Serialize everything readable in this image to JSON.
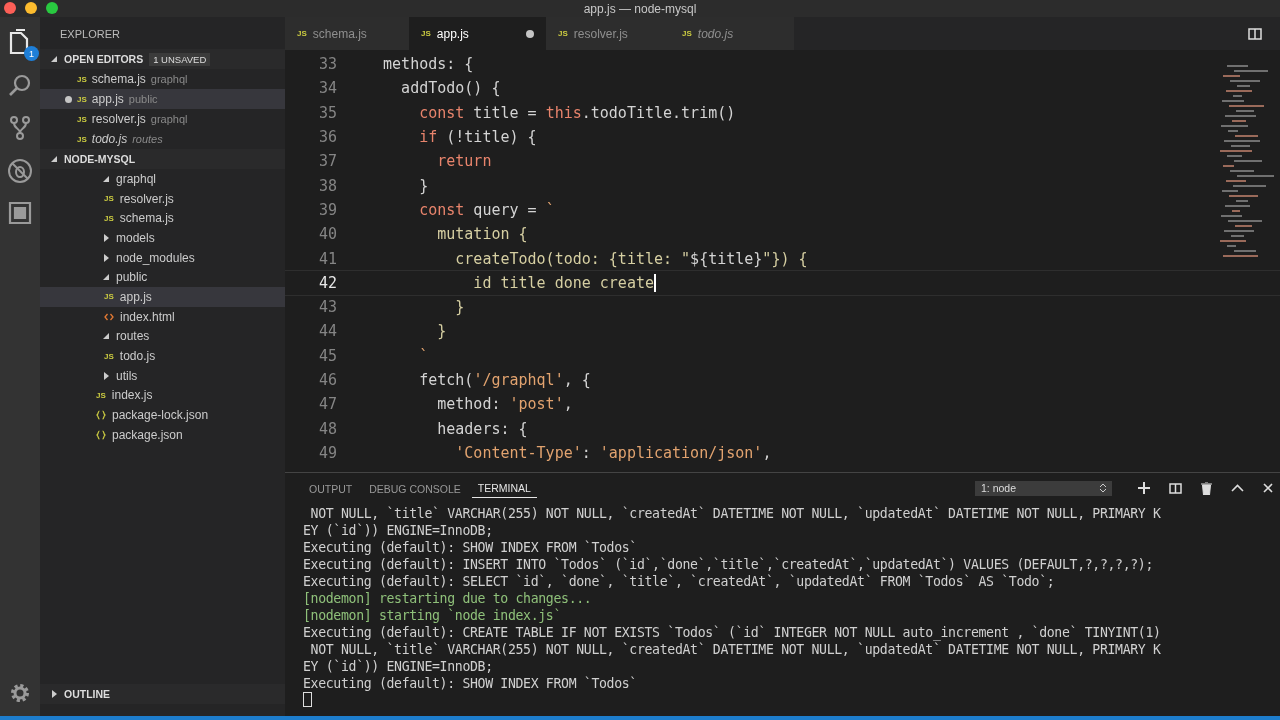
{
  "window": {
    "title": "app.js — node-mysql"
  },
  "activity_bar": {
    "explorer_badge": "1"
  },
  "sidebar": {
    "title": "EXPLORER",
    "open_editors": {
      "title": "OPEN EDITORS",
      "badge": "1 UNSAVED",
      "expanded": true,
      "items": [
        {
          "icon": "JS",
          "name": "schema.js",
          "folder": "graphql",
          "unsaved": false,
          "preview": false,
          "selected": false
        },
        {
          "icon": "JS",
          "name": "app.js",
          "folder": "public",
          "unsaved": true,
          "preview": false,
          "selected": true
        },
        {
          "icon": "JS",
          "name": "resolver.js",
          "folder": "graphql",
          "unsaved": false,
          "preview": false,
          "selected": false
        },
        {
          "icon": "JS",
          "name": "todo.js",
          "folder": "routes",
          "unsaved": false,
          "preview": true,
          "selected": false
        }
      ]
    },
    "project": {
      "title": "NODE-MYSQL",
      "expanded": true,
      "tree": [
        {
          "name": "graphql",
          "kind": "folder",
          "expanded": true,
          "selected": false,
          "children": [
            {
              "icon": "JS",
              "name": "resolver.js",
              "kind": "js",
              "selected": false
            },
            {
              "icon": "JS",
              "name": "schema.js",
              "kind": "js",
              "selected": false
            }
          ]
        },
        {
          "name": "models",
          "kind": "folder",
          "expanded": false,
          "selected": false
        },
        {
          "name": "node_modules",
          "kind": "folder",
          "expanded": false,
          "selected": false
        },
        {
          "name": "public",
          "kind": "folder",
          "expanded": true,
          "selected": false,
          "children": [
            {
              "icon": "JS",
              "name": "app.js",
              "kind": "js",
              "selected": true
            },
            {
              "name": "index.html",
              "kind": "html",
              "selected": false
            }
          ]
        },
        {
          "name": "routes",
          "kind": "folder",
          "expanded": true,
          "selected": false,
          "children": [
            {
              "icon": "JS",
              "name": "todo.js",
              "kind": "js",
              "selected": false
            }
          ]
        },
        {
          "name": "utils",
          "kind": "folder",
          "expanded": false,
          "selected": false
        },
        {
          "icon": "JS",
          "name": "index.js",
          "kind": "js",
          "selected": false
        },
        {
          "name": "package-lock.json",
          "kind": "json",
          "selected": false
        },
        {
          "name": "package.json",
          "kind": "json",
          "selected": false
        }
      ]
    },
    "outline": {
      "title": "OUTLINE",
      "expanded": false
    }
  },
  "tabs": [
    {
      "icon": "JS",
      "label": "schema.js",
      "selected": false,
      "unsaved": false,
      "preview": false
    },
    {
      "icon": "JS",
      "label": "app.js",
      "selected": true,
      "unsaved": true,
      "preview": false
    },
    {
      "icon": "JS",
      "label": "resolver.js",
      "selected": false,
      "unsaved": false,
      "preview": false
    },
    {
      "icon": "JS",
      "label": "todo.js",
      "selected": false,
      "unsaved": false,
      "preview": true
    }
  ],
  "editor": {
    "lines": [
      {
        "number": "33",
        "current": false,
        "tokens": [
          {
            "text": "  methods: {",
            "kind": "plain"
          }
        ]
      },
      {
        "number": "34",
        "current": false,
        "tokens": [
          {
            "text": "    addTodo() {",
            "kind": "plain"
          }
        ]
      },
      {
        "number": "35",
        "current": false,
        "tokens": [
          {
            "text": "      const",
            "kind": "keyword"
          },
          {
            "text": " title = ",
            "kind": "plain"
          },
          {
            "text": "this",
            "kind": "keyword"
          },
          {
            "text": ".todoTitle.trim()",
            "kind": "plain"
          }
        ]
      },
      {
        "number": "36",
        "current": false,
        "tokens": [
          {
            "text": "      if",
            "kind": "keyword"
          },
          {
            "text": " (!title) {",
            "kind": "plain"
          }
        ]
      },
      {
        "number": "37",
        "current": false,
        "tokens": [
          {
            "text": "        return",
            "kind": "keyword"
          }
        ]
      },
      {
        "number": "38",
        "current": false,
        "tokens": [
          {
            "text": "      }",
            "kind": "plain"
          }
        ]
      },
      {
        "number": "39",
        "current": false,
        "tokens": [
          {
            "text": "      const",
            "kind": "keyword"
          },
          {
            "text": " query = ",
            "kind": "plain"
          },
          {
            "text": "`",
            "kind": "string"
          }
        ]
      },
      {
        "number": "40",
        "current": false,
        "tokens": [
          {
            "text": "        mutation {",
            "kind": "template"
          }
        ]
      },
      {
        "number": "41",
        "current": false,
        "tokens": [
          {
            "text": "          createTodo(todo: {title: \"",
            "kind": "template"
          },
          {
            "text": "${title}",
            "kind": "plain"
          },
          {
            "text": "\"}) {",
            "kind": "template"
          }
        ]
      },
      {
        "number": "42",
        "current": true,
        "tokens": [
          {
            "text": "            id title done create",
            "kind": "template"
          }
        ]
      },
      {
        "number": "43",
        "current": false,
        "tokens": [
          {
            "text": "          }",
            "kind": "template"
          }
        ]
      },
      {
        "number": "44",
        "current": false,
        "tokens": [
          {
            "text": "        }",
            "kind": "template"
          }
        ]
      },
      {
        "number": "45",
        "current": false,
        "tokens": [
          {
            "text": "      `",
            "kind": "string"
          }
        ]
      },
      {
        "number": "46",
        "current": false,
        "tokens": [
          {
            "text": "      fetch(",
            "kind": "plain"
          },
          {
            "text": "'/graphql'",
            "kind": "string"
          },
          {
            "text": ", {",
            "kind": "plain"
          }
        ]
      },
      {
        "number": "47",
        "current": false,
        "tokens": [
          {
            "text": "        method: ",
            "kind": "plain"
          },
          {
            "text": "'post'",
            "kind": "string"
          },
          {
            "text": ",",
            "kind": "plain"
          }
        ]
      },
      {
        "number": "48",
        "current": false,
        "tokens": [
          {
            "text": "        headers: {",
            "kind": "plain"
          }
        ]
      },
      {
        "number": "49",
        "current": false,
        "tokens": [
          {
            "text": "          'Content-Type'",
            "kind": "string"
          },
          {
            "text": ": ",
            "kind": "plain"
          },
          {
            "text": "'application/json'",
            "kind": "string"
          },
          {
            "text": ",",
            "kind": "plain"
          }
        ]
      }
    ]
  },
  "panel": {
    "tabs": [
      {
        "label": "OUTPUT",
        "selected": false
      },
      {
        "label": "DEBUG CONSOLE",
        "selected": false
      },
      {
        "label": "TERMINAL",
        "selected": true
      }
    ],
    "terminal_select": "1: node",
    "terminal": {
      "cursor": true,
      "lines": [
        {
          "text": " NOT NULL, `title` VARCHAR(255) NOT NULL, `createdAt` DATETIME NOT NULL, `updatedAt` DATETIME NOT NULL, PRIMARY K",
          "kind": "output"
        },
        {
          "text": "EY (`id`)) ENGINE=InnoDB;",
          "kind": "output"
        },
        {
          "text": "Executing (default): SHOW INDEX FROM `Todos`",
          "kind": "output"
        },
        {
          "text": "Executing (default): INSERT INTO `Todos` (`id`,`done`,`title`,`createdAt`,`updatedAt`) VALUES (DEFAULT,?,?,?,?);",
          "kind": "output"
        },
        {
          "text": "Executing (default): SELECT `id`, `done`, `title`, `createdAt`, `updatedAt` FROM `Todos` AS `Todo`;",
          "kind": "output"
        },
        {
          "text": "[nodemon] restarting due to changes...",
          "kind": "nodemon"
        },
        {
          "text": "[nodemon] starting `node index.js`",
          "kind": "nodemon"
        },
        {
          "text": "Executing (default): CREATE TABLE IF NOT EXISTS `Todos` (`id` INTEGER NOT NULL auto_increment , `done` TINYINT(1)",
          "kind": "output"
        },
        {
          "text": " NOT NULL, `title` VARCHAR(255) NOT NULL, `createdAt` DATETIME NOT NULL, `updatedAt` DATETIME NOT NULL, PRIMARY K",
          "kind": "output"
        },
        {
          "text": "EY (`id`)) ENGINE=InnoDB;",
          "kind": "output"
        },
        {
          "text": "Executing (default): SHOW INDEX FROM `Todos`",
          "kind": "output"
        }
      ]
    }
  }
}
